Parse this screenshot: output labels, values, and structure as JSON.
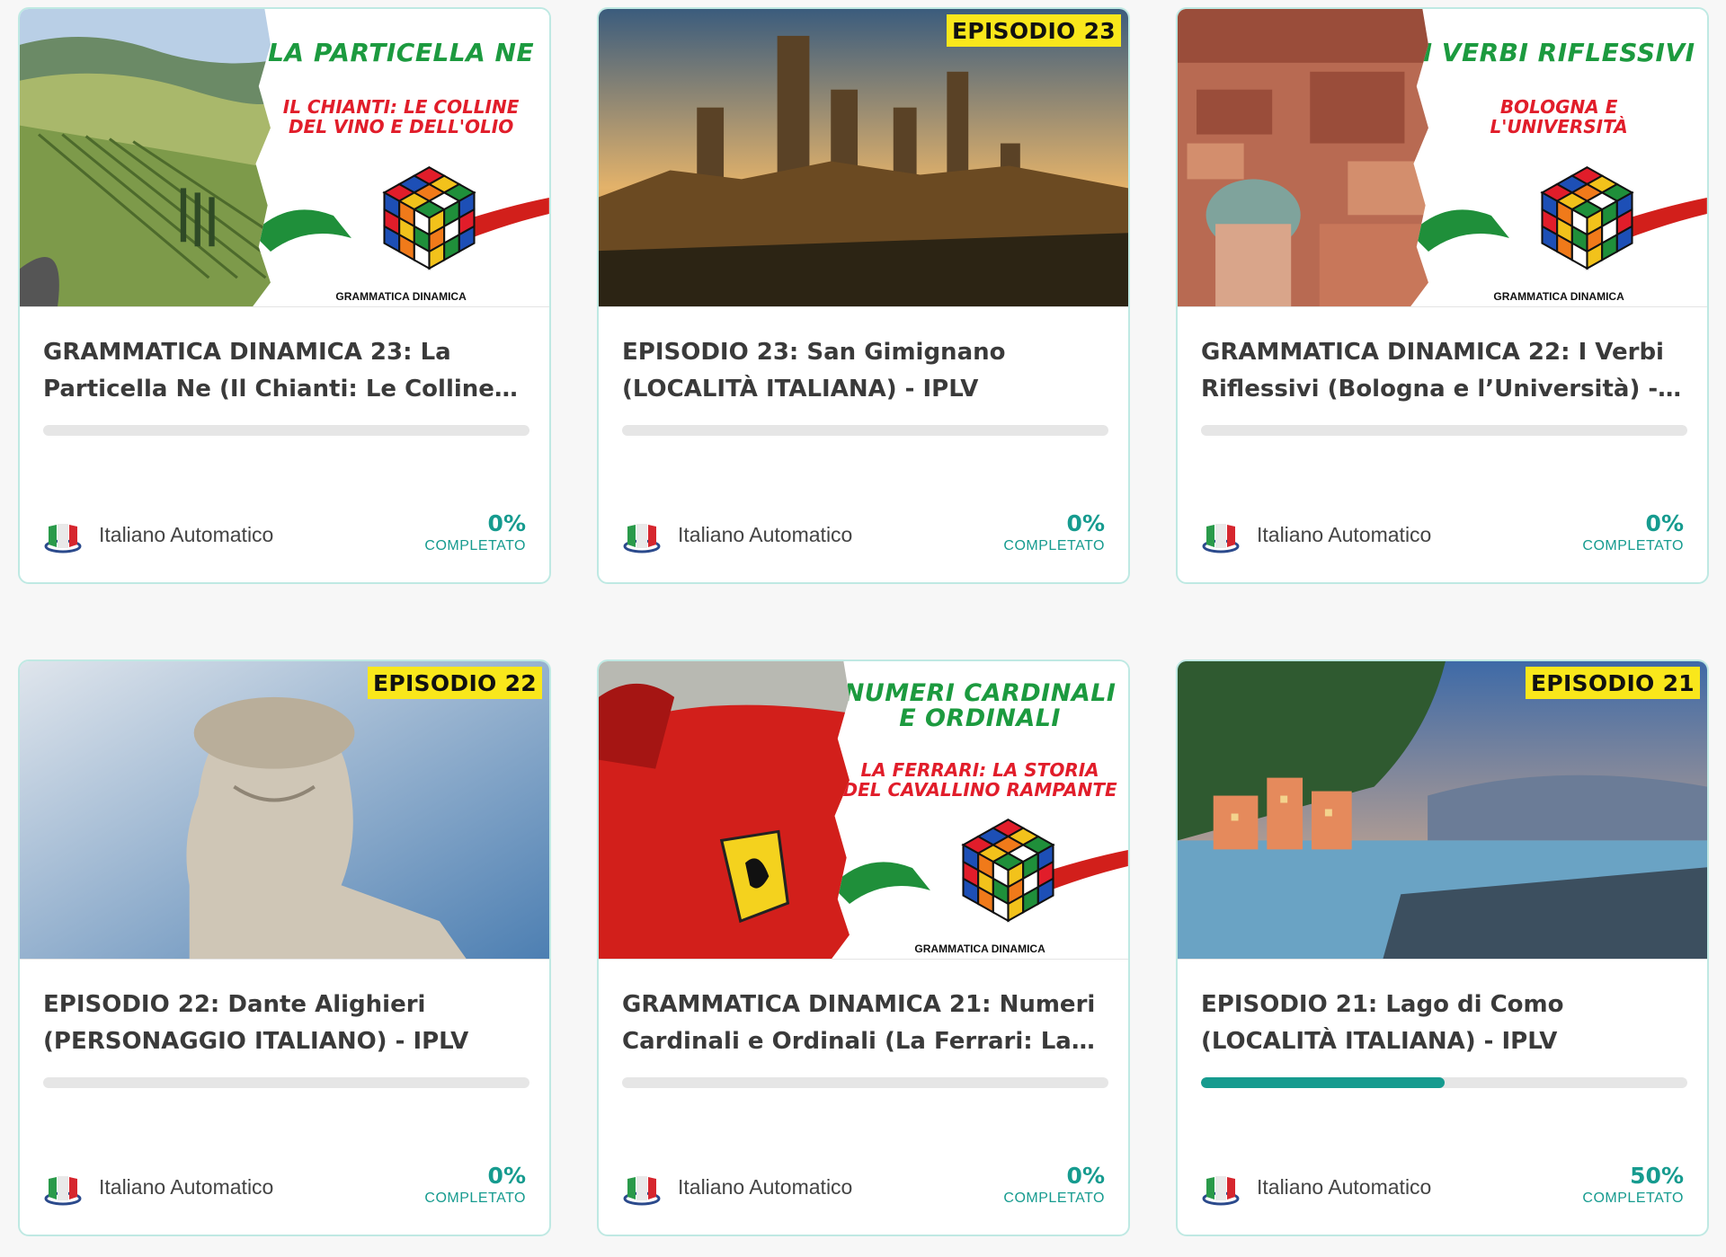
{
  "courses": [
    {
      "title": "GRAMMATICA DINAMICA 23: La Particella Ne (Il Chianti: Le Colline Del Vino e...",
      "thumb": {
        "type": "grammar",
        "panel_title": "LA PARTICELLA NE",
        "panel_sub": "IL CHIANTI: LE COLLINE\nDEL VINO E DELL'OLIO",
        "brand": "GRAMMATICA DINAMICA",
        "scene": "vineyard"
      },
      "author": "Italiano Automatico",
      "progress_percent": 0,
      "percent_label": "0%",
      "completed_label": "COMPLETATO"
    },
    {
      "title": "EPISODIO 23: San Gimignano (LOCALITÀ ITALIANA) - IPLV",
      "thumb": {
        "type": "episode",
        "badge": "EPISODIO 23",
        "scene": "towers"
      },
      "author": "Italiano Automatico",
      "progress_percent": 0,
      "percent_label": "0%",
      "completed_label": "COMPLETATO"
    },
    {
      "title": "GRAMMATICA DINAMICA 22: I Verbi Riflessivi (Bologna e l’Università) - IPLV",
      "thumb": {
        "type": "grammar",
        "panel_title": "I VERBI RIFLESSIVI",
        "panel_sub": "BOLOGNA E\nL'UNIVERSITÀ",
        "brand": "GRAMMATICA DINAMICA",
        "scene": "city"
      },
      "author": "Italiano Automatico",
      "progress_percent": 0,
      "percent_label": "0%",
      "completed_label": "COMPLETATO"
    },
    {
      "title": "EPISODIO 22: Dante Alighieri (PERSONAGGIO ITALIANO) - IPLV",
      "thumb": {
        "type": "episode",
        "badge": "EPISODIO 22",
        "scene": "statue"
      },
      "author": "Italiano Automatico",
      "progress_percent": 0,
      "percent_label": "0%",
      "completed_label": "COMPLETATO"
    },
    {
      "title": "GRAMMATICA DINAMICA 21: Numeri Cardinali e Ordinali (La Ferrari: La Stor...",
      "thumb": {
        "type": "grammar",
        "panel_title": "NUMERI CARDINALI\nE ORDINALI",
        "panel_sub": "LA FERRARI: LA STORIA\nDEL CAVALLINO RAMPANTE",
        "brand": "GRAMMATICA DINAMICA",
        "scene": "car"
      },
      "author": "Italiano Automatico",
      "progress_percent": 0,
      "percent_label": "0%",
      "completed_label": "COMPLETATO"
    },
    {
      "title": "EPISODIO 21: Lago di Como (LOCALITÀ ITALIANA) - IPLV",
      "thumb": {
        "type": "episode",
        "badge": "EPISODIO 21",
        "scene": "lake"
      },
      "author": "Italiano Automatico",
      "progress_percent": 50,
      "percent_label": "50%",
      "completed_label": "COMPLETATO"
    }
  ],
  "colors": {
    "accent": "#169b8f",
    "card_border": "#bfe9e3",
    "track": "#e6e6e6",
    "badge_yellow": "#f9e71b",
    "panel_green": "#1c9a3f",
    "panel_red": "#e11d2a"
  }
}
